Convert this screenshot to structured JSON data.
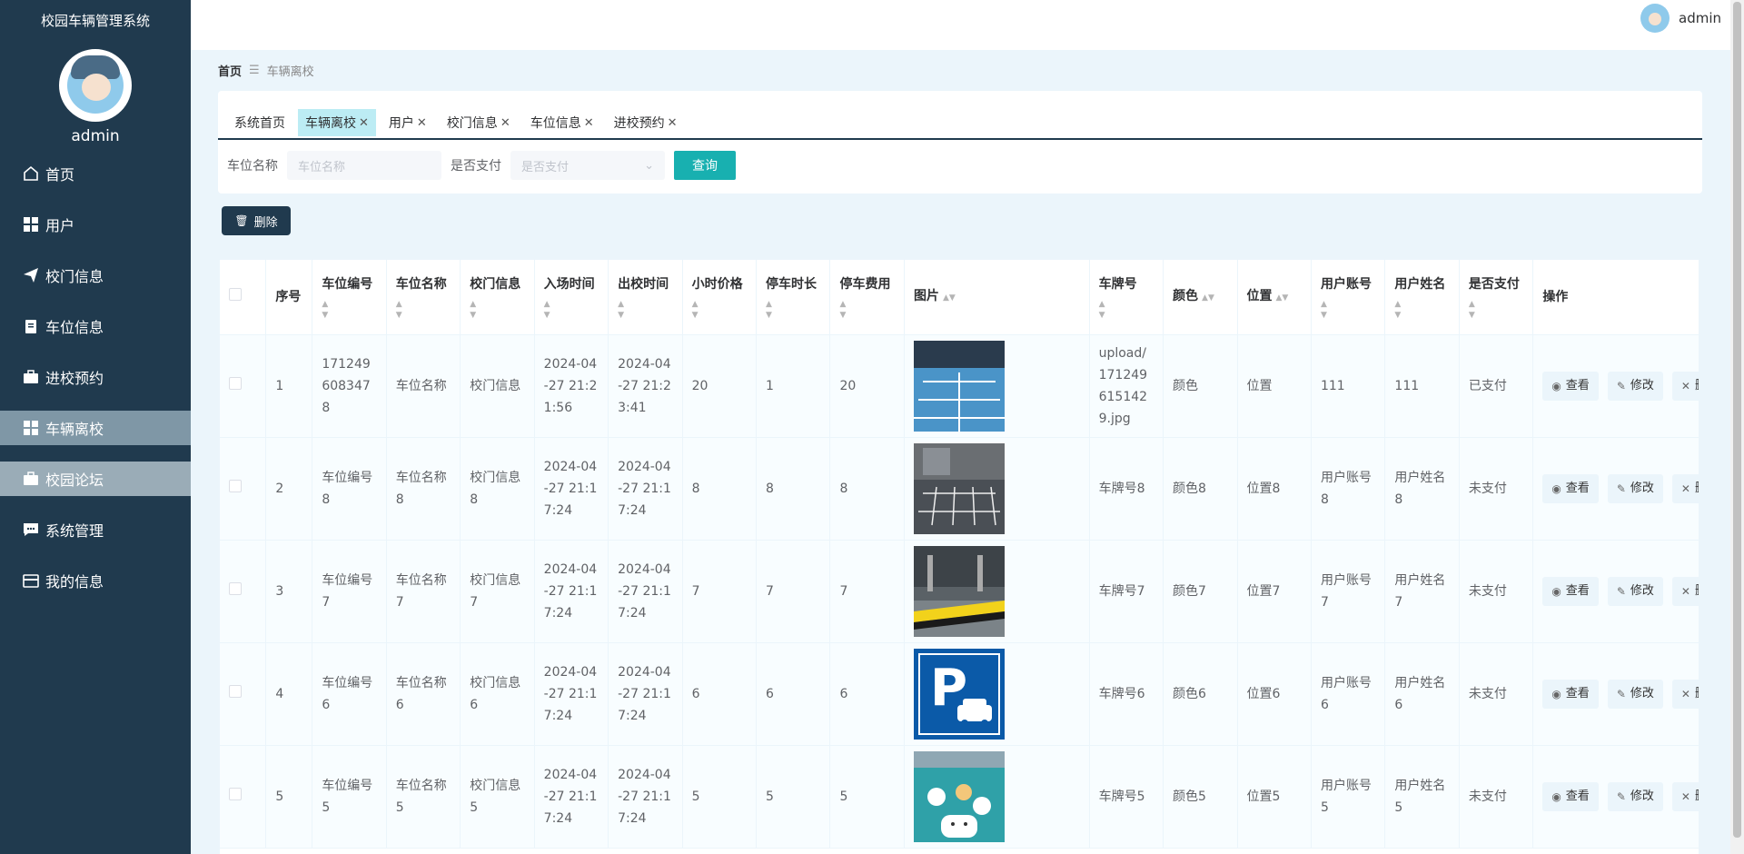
{
  "app_title": "校园车辆管理系统",
  "user": {
    "name": "admin"
  },
  "sidebar": {
    "items": [
      {
        "label": "首页",
        "icon": "home-icon"
      },
      {
        "label": "用户",
        "icon": "grid-icon"
      },
      {
        "label": "校门信息",
        "icon": "send-icon"
      },
      {
        "label": "车位信息",
        "icon": "clipboard-icon"
      },
      {
        "label": "进校预约",
        "icon": "briefcase-icon"
      },
      {
        "label": "车辆离校",
        "icon": "grid-icon"
      },
      {
        "label": "校园论坛",
        "icon": "briefcase-icon"
      },
      {
        "label": "系统管理",
        "icon": "chat-icon"
      },
      {
        "label": "我的信息",
        "icon": "wallet-icon"
      }
    ]
  },
  "breadcrumb": {
    "home": "首页",
    "separator": "☰",
    "current": "车辆离校"
  },
  "tabs": [
    {
      "label": "系统首页",
      "closable": false
    },
    {
      "label": "车辆离校",
      "closable": true
    },
    {
      "label": "用户",
      "closable": true
    },
    {
      "label": "校门信息",
      "closable": true
    },
    {
      "label": "车位信息",
      "closable": true
    },
    {
      "label": "进校预约",
      "closable": true
    }
  ],
  "filter": {
    "name_label": "车位名称",
    "name_placeholder": "车位名称",
    "paid_label": "是否支付",
    "paid_placeholder": "是否支付",
    "query_button": "查询"
  },
  "toolbar": {
    "delete_button": "删除"
  },
  "table": {
    "headers": {
      "index": "序号",
      "code": "车位编号",
      "name": "车位名称",
      "gate": "校门信息",
      "in_time": "入场时间",
      "out_time": "出校时间",
      "hour_price": "小时价格",
      "duration": "停车时长",
      "fee": "停车费用",
      "image": "图片",
      "plate": "车牌号",
      "color": "颜色",
      "location": "位置",
      "account": "用户账号",
      "username": "用户姓名",
      "paid": "是否支付",
      "action": "操作"
    },
    "action_labels": {
      "view": "查看",
      "edit": "修改",
      "delete": "删除"
    },
    "rows": [
      {
        "index": "1",
        "code": "1712496083478",
        "name": "车位名称",
        "gate": "校门信息",
        "in_time": "2024-04-27 21:21:56",
        "out_time": "2024-04-27 21:23:41",
        "hour_price": "20",
        "duration": "1",
        "fee": "20",
        "image": "parking-lot-blue",
        "plate": "upload/1712496151429.jpg",
        "color": "颜色",
        "location": "位置",
        "account": "111",
        "username": "111",
        "paid": "已支付"
      },
      {
        "index": "2",
        "code": "车位编号8",
        "name": "车位名称8",
        "gate": "校门信息8",
        "in_time": "2024-04-27 21:17:24",
        "out_time": "2024-04-27 21:17:24",
        "hour_price": "8",
        "duration": "8",
        "fee": "8",
        "image": "parking-lot-dark",
        "plate": "车牌号8",
        "color": "颜色8",
        "location": "位置8",
        "account": "用户账号8",
        "username": "用户姓名8",
        "paid": "未支付"
      },
      {
        "index": "3",
        "code": "车位编号7",
        "name": "车位名称7",
        "gate": "校门信息7",
        "in_time": "2024-04-27 21:17:24",
        "out_time": "2024-04-27 21:17:24",
        "hour_price": "7",
        "duration": "7",
        "fee": "7",
        "image": "parking-garage-yellow",
        "plate": "车牌号7",
        "color": "颜色7",
        "location": "位置7",
        "account": "用户账号7",
        "username": "用户姓名7",
        "paid": "未支付"
      },
      {
        "index": "4",
        "code": "车位编号6",
        "name": "车位名称6",
        "gate": "校门信息6",
        "in_time": "2024-04-27 21:17:24",
        "out_time": "2024-04-27 21:17:24",
        "hour_price": "6",
        "duration": "6",
        "fee": "6",
        "image": "parking-sign",
        "plate": "车牌号6",
        "color": "颜色6",
        "location": "位置6",
        "account": "用户账号6",
        "username": "用户姓名6",
        "paid": "未支付"
      },
      {
        "index": "5",
        "code": "车位编号5",
        "name": "车位名称5",
        "gate": "校门信息5",
        "in_time": "2024-04-27 21:17:24",
        "out_time": "2024-04-27 21:17:24",
        "hour_price": "5",
        "duration": "5",
        "fee": "5",
        "image": "parking-cartoon",
        "plate": "车牌号5",
        "color": "颜色5",
        "location": "位置5",
        "account": "用户账号5",
        "username": "用户姓名5",
        "paid": "未支付"
      }
    ]
  },
  "colors": {
    "sidebar_bg": "#203a4e",
    "accent": "#18b0b0",
    "active_tab": "#bcecf4",
    "page_bg": "#ebf5fb"
  }
}
